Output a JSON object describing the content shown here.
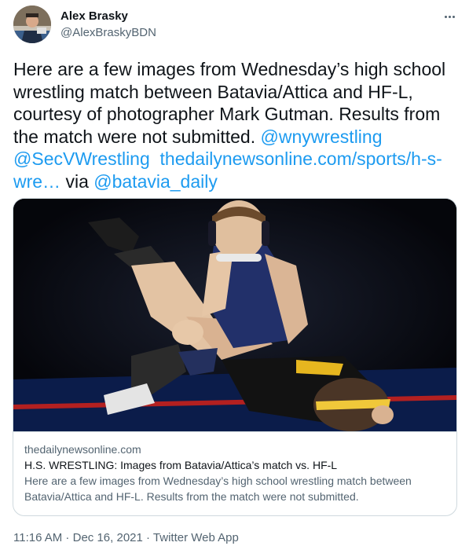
{
  "author": {
    "name": "Alex Brasky",
    "handle": "@AlexBraskyBDN"
  },
  "tweet": {
    "text_part1": "Here are a few images from Wednesday’s high school wrestling match between Batavia/Attica and HF-L, courtesy of photographer Mark Gutman. Results from the match were not submitted. ",
    "mention1": "@wnywrestling",
    "mention2": "@SecVWrestling",
    "link": "thedailynewsonline.com/sports/h-s-wre…",
    "via_label": " via ",
    "mention3": "@batavia_daily"
  },
  "card": {
    "domain": "thedailynewsonline.com",
    "title": "H.S. WRESTLING: Images from Batavia/Attica’s match vs. HF-L",
    "description": "Here are a few images from Wednesday’s high school wrestling match between Batavia/Attica and HF-L. Results from the match were not submitted."
  },
  "meta": {
    "time": "11:16 AM",
    "separator": " · ",
    "date": "Dec 16, 2021",
    "source": "Twitter Web App"
  },
  "icons": {
    "more": "more-horizontal-icon"
  },
  "colors": {
    "link": "#1d9bf0",
    "secondary_text": "#536471",
    "border": "#cfd9de"
  }
}
